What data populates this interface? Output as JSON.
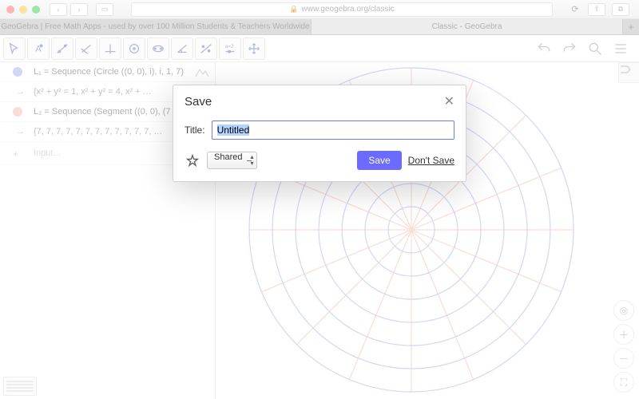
{
  "browser": {
    "url": "www.geogebra.org/classic",
    "tabs": [
      "GeoGebra | Free Math Apps - used by over 100 Million Students & Teachers Worldwide",
      "Classic - GeoGebra"
    ]
  },
  "algebra": {
    "l1": {
      "label": "L₁ = Sequence (Circle ((0, 0), i), i, 1, 7)",
      "detail": "{x² + y² = 1, x² + y² = 4, x² + …",
      "color": "#9fa8e8"
    },
    "l2": {
      "label": "L₂ = Sequence (Segment ((0, 0), (7 co…",
      "detail": "{7, 7, 7, 7, 7, 7, 7, 7, 7, 7, 7, 7, …",
      "color": "#f2b4a8"
    },
    "input_placeholder": "Input..."
  },
  "modal": {
    "title": "Save",
    "title_label": "Title:",
    "title_value": "Untitled",
    "share_value": "Shared",
    "save_label": "Save",
    "dont_save_label": "Don't Save"
  }
}
